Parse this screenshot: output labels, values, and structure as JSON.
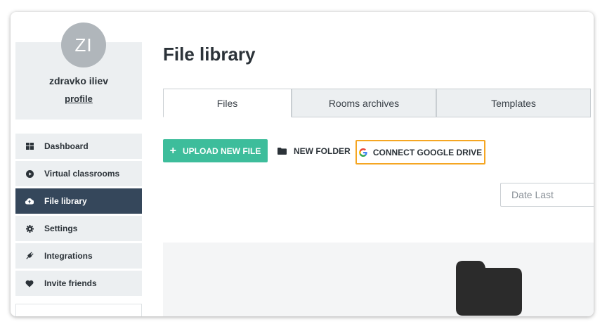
{
  "profile": {
    "initials": "ZI",
    "name": "zdravko iliev",
    "link_label": "profile"
  },
  "sidebar": {
    "items": [
      {
        "label": "Dashboard",
        "icon": "dashboard-icon"
      },
      {
        "label": "Virtual classrooms",
        "icon": "play-circle-icon"
      },
      {
        "label": "File library",
        "icon": "cloud-upload-icon",
        "active": true
      },
      {
        "label": "Settings",
        "icon": "gear-icon"
      },
      {
        "label": "Integrations",
        "icon": "plug-icon"
      },
      {
        "label": "Invite friends",
        "icon": "heart-icon"
      }
    ]
  },
  "main": {
    "title": "File library",
    "tabs": [
      {
        "label": "Files",
        "active": true
      },
      {
        "label": "Rooms archives"
      },
      {
        "label": "Templates"
      }
    ],
    "actions": {
      "upload": "UPLOAD NEW FILE",
      "new_folder": "NEW FOLDER",
      "google_drive": "CONNECT GOOGLE DRIVE"
    },
    "sort": {
      "placeholder": "Date Last"
    }
  },
  "colors": {
    "accent": "#3dbd9b",
    "active_nav": "#35475b",
    "highlight": "#f5a623"
  }
}
